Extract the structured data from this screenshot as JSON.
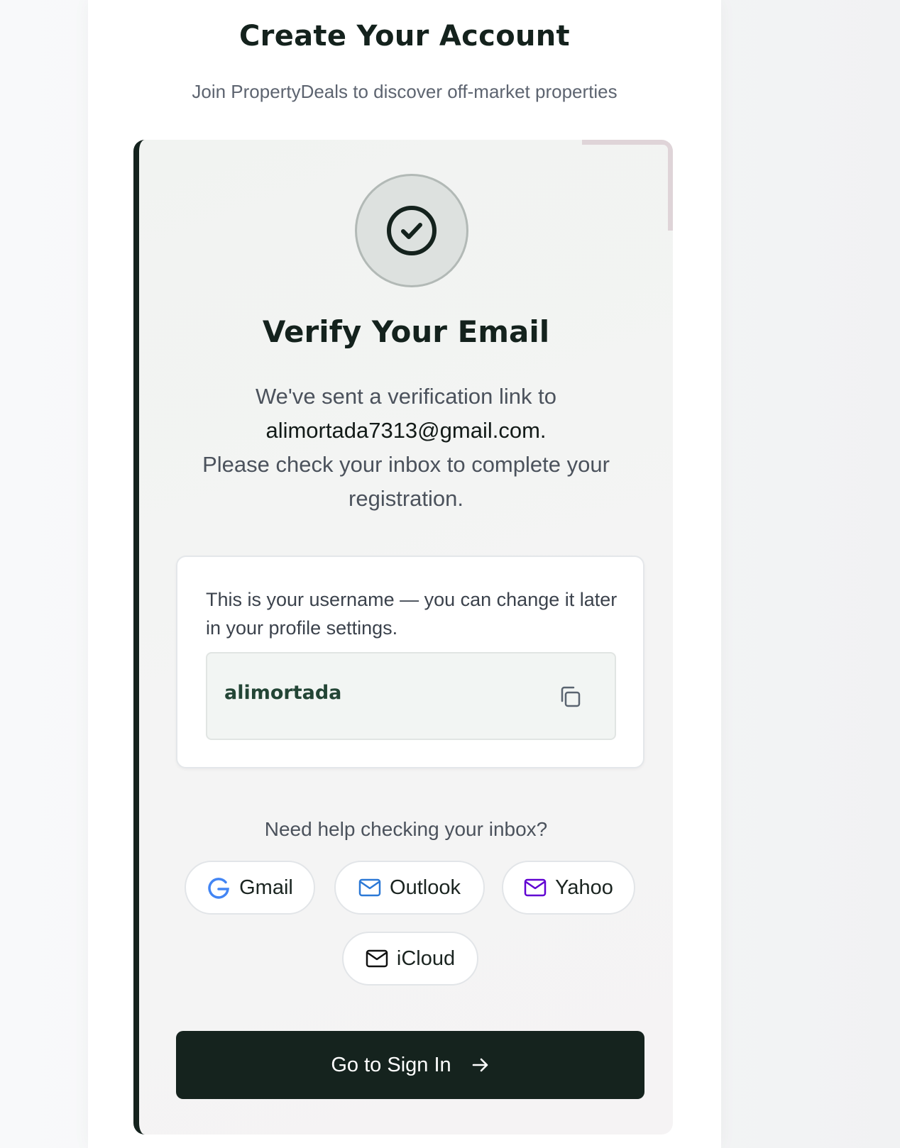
{
  "header": {
    "title": "Create Your Account",
    "subtitle": "Join PropertyDeals to discover off-market properties"
  },
  "verify": {
    "title": "Verify Your Email",
    "line1": "We've sent a verification link to",
    "email": "alimortada7313@gmail.com.",
    "line2": "Please check your inbox to complete your registration."
  },
  "username": {
    "note": "This is your username — you can change it later in your profile settings.",
    "value": "alimortada"
  },
  "help": {
    "text": "Need help checking your inbox?",
    "providers": [
      {
        "label": "Gmail",
        "icon": "google-g-icon",
        "color": "#4285f4"
      },
      {
        "label": "Outlook",
        "icon": "mail-icon",
        "color": "#2b78d6"
      },
      {
        "label": "Yahoo",
        "icon": "mail-icon",
        "color": "#6001d2"
      },
      {
        "label": "iCloud",
        "icon": "mail-icon",
        "color": "#111111"
      }
    ]
  },
  "actions": {
    "signin_label": "Go to Sign In",
    "signin_icon": "arrow-right-icon"
  },
  "colors": {
    "primary": "#15231e",
    "accent_pink": "#dfd4d8"
  }
}
